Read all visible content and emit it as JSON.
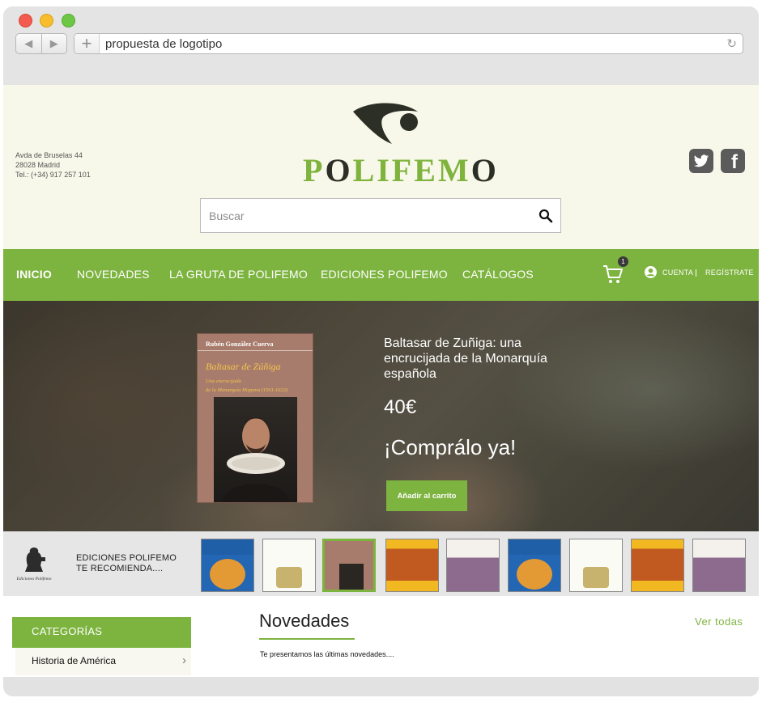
{
  "browser": {
    "url": "propuesta de logotipo",
    "back_glyph": "◀",
    "forward_glyph": "▶",
    "new_tab_glyph": "+",
    "reload_glyph": "↻"
  },
  "header": {
    "address": [
      "Avda de Bruselas 44",
      "28028 Madrid",
      "Tel.: (+34) 917 257 101"
    ],
    "logo": {
      "p": "P",
      "o1": "O",
      "middle": "LIFEM",
      "o2": "O"
    },
    "search_placeholder": "Buscar",
    "social": {
      "twitter": "t",
      "facebook": "f"
    }
  },
  "nav": {
    "items": [
      "INICIO",
      "NOVEDADES",
      "LA GRUTA DE POLIFEMO",
      "EDICIONES POLIFEMO",
      "CATÁLOGOS"
    ],
    "cart_count": "1",
    "account": "CUENTA",
    "register": "REGÍSTRATE"
  },
  "hero": {
    "book_author": "Rubén González Cuerva",
    "book_title": "Baltasar de Zúñiga",
    "book_subtitle_1": "Una encrucijada",
    "book_subtitle_2": "de la Monarquía Hispana (1561-1622)",
    "title": "Baltasar de Zuñiga: una encrucijada de la Monarquía española",
    "price": "40€",
    "cta": "¡Comprálo ya!",
    "button": "Añadir al carrito"
  },
  "recommend": {
    "line1": "EDICIONES POLIFEMO",
    "line2": "TE RECOMIENDA....",
    "logo_caption": "Ediciones Polifemo"
  },
  "categories": {
    "heading": "CATEGORÍAS",
    "items": [
      "Historia de América"
    ]
  },
  "novedades": {
    "title": "Novedades",
    "subtitle": "Te presentamos las últimas novedades....",
    "see_all": "Ver todas"
  },
  "colors": {
    "brand_green": "#7db33f",
    "logo_dark": "#2c2f25",
    "header_bg": "#f7f8e9"
  }
}
